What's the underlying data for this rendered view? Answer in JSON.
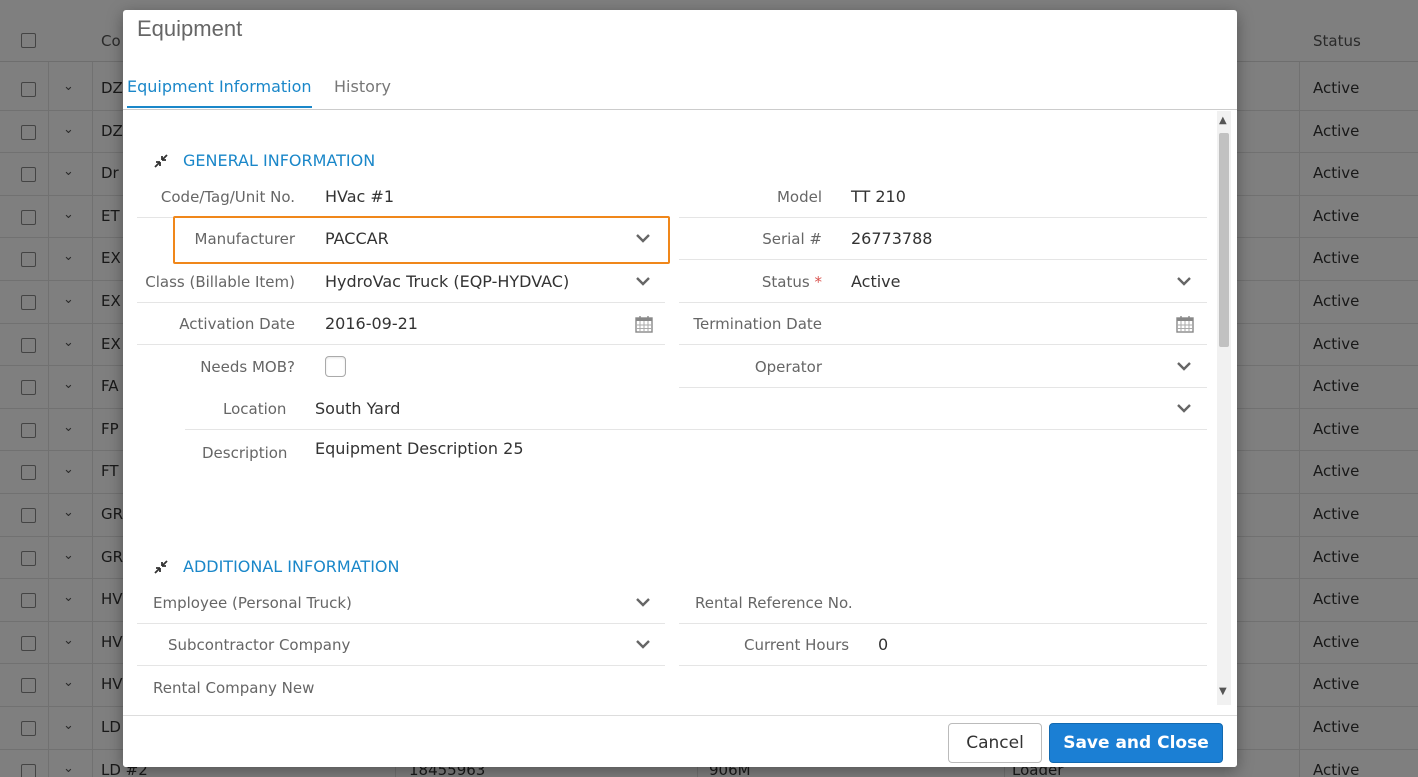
{
  "background": {
    "headers": {
      "code": "Co",
      "status": "Status"
    },
    "rows": [
      {
        "code": "DZ",
        "status": "Active"
      },
      {
        "code": "DZ",
        "status": "Active"
      },
      {
        "code": "Dr",
        "status": "Active"
      },
      {
        "code": "ET",
        "status": "Active"
      },
      {
        "code": "EX",
        "status": "Active"
      },
      {
        "code": "EX",
        "status": "Active"
      },
      {
        "code": "EX",
        "status": "Active"
      },
      {
        "code": "FA",
        "status": "Active"
      },
      {
        "code": "FP",
        "status": "Active"
      },
      {
        "code": "FT",
        "status": "Active"
      },
      {
        "code": "GR",
        "status": "Active"
      },
      {
        "code": "GR",
        "status": "Active"
      },
      {
        "code": "HV",
        "status": "Active"
      },
      {
        "code": "HV",
        "status": "Active"
      },
      {
        "code": "HV",
        "status": "Active"
      },
      {
        "code": "LD",
        "status": "Active"
      },
      {
        "code": "LD #2",
        "serial": "18455963",
        "model": "906M",
        "type": "Loader",
        "status": "Active"
      }
    ]
  },
  "modal": {
    "title": "Equipment",
    "tabs": [
      "Equipment Information",
      "History"
    ],
    "general": {
      "heading": "GENERAL INFORMATION",
      "code_label": "Code/Tag/Unit No.",
      "code_value": "HVac #1",
      "model_label": "Model",
      "model_value": "TT 210",
      "manufacturer_label": "Manufacturer",
      "manufacturer_value": "PACCAR",
      "serial_label": "Serial #",
      "serial_value": "26773788",
      "class_label": "Class (Billable Item)",
      "class_value": "HydroVac Truck (EQP-HYDVAC)",
      "status_label": "Status",
      "status_required": "*",
      "status_value": "Active",
      "activation_label": "Activation Date",
      "activation_value": "2016-09-21",
      "termination_label": "Termination Date",
      "termination_value": "",
      "mob_label": "Needs MOB?",
      "operator_label": "Operator",
      "operator_value": "",
      "location_label": "Location",
      "location_value": "South Yard",
      "description_label": "Description",
      "description_value": "Equipment Description 25"
    },
    "additional": {
      "heading": "ADDITIONAL INFORMATION",
      "employee_label": "Employee (Personal Truck)",
      "rental_ref_label": "Rental Reference No.",
      "subcontractor_label": "Subcontractor Company",
      "current_hours_label": "Current Hours",
      "current_hours_value": "0",
      "rental_company_label": "Rental Company New"
    },
    "footer": {
      "cancel_label": "Cancel",
      "save_label": "Save and Close"
    }
  },
  "colors": {
    "accent": "#1a87c9",
    "highlight": "#f0871a",
    "primary_button": "#1b7fd4",
    "required": "#d9534f"
  },
  "icons": {
    "collapse": "collapse-arrows-icon",
    "dropdown": "chevron-down-icon",
    "calendar": "calendar-icon"
  }
}
